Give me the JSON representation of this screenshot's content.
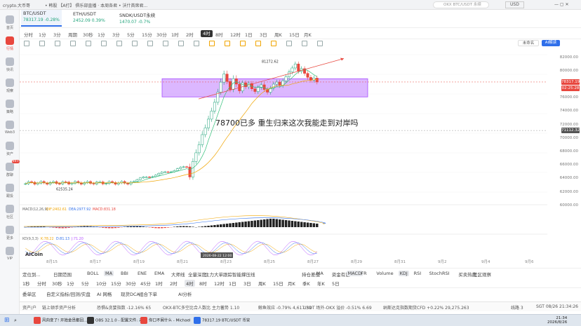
{
  "titlebar": {
    "app_name": "crypto.大币哥",
    "tabs_text": "• 韩股 【A打】 俱乐部直播 · 本周各君 • 沃什首席君...",
    "search_placeholder": "OKX BTC/USDT 永续",
    "currency": "USD"
  },
  "sidebar": {
    "items": [
      {
        "label": "首页"
      },
      {
        "label": "行情",
        "active": true
      },
      {
        "label": "快讯"
      },
      {
        "label": "观察"
      },
      {
        "label": "策略"
      },
      {
        "label": "Web3"
      },
      {
        "label": "资产"
      },
      {
        "label": "群聊",
        "badge": "99+"
      },
      {
        "label": "跟投"
      },
      {
        "label": "社区"
      },
      {
        "label": "更多"
      },
      {
        "label": "VIP"
      }
    ]
  },
  "tickers": [
    {
      "name": "BTC/USDT",
      "price": "78317.19",
      "change": "-0.28%",
      "active": true
    },
    {
      "name": "ETH/USDT",
      "price": "2452.09",
      "change": "0.39%"
    },
    {
      "name": "SNDK/USDT永续",
      "price": "1470.07",
      "change": "-0.7%"
    }
  ],
  "timeframes": [
    "1秒",
    "15秒",
    "1分",
    "3分",
    "5分",
    "10分",
    "15分",
    "30分",
    "45分",
    "1时",
    "2时",
    "3时",
    "4时",
    "8时",
    "12时",
    "1日",
    "3日",
    "周K",
    "15日",
    "月K"
  ],
  "timeframes_top": [
    "分时",
    "1分",
    "3分",
    "周期",
    "30秒",
    "1分",
    "3分",
    "5分",
    "15分",
    "30分",
    "1时",
    "2时",
    "4时",
    "8时",
    "12时",
    "1日",
    "3日",
    "周K",
    "15日",
    "月K"
  ],
  "active_timeframe": "4时",
  "toolbar": {
    "right_label": "未命名",
    "ai_button": "AI解读"
  },
  "price_axis": {
    "labels": [
      "82000.00",
      "80000.00",
      "76000.00",
      "74000.00",
      "72000.00",
      "70000.00",
      "68000.00",
      "66000.00",
      "64000.00",
      "62000.00",
      "60000.00"
    ],
    "current_price": "78317.19",
    "countdown": "02:25:28",
    "crosshair_price": "71112.32"
  },
  "chart_annotations": {
    "high_label": "81272.62",
    "low_label": "62535.24",
    "overlay_text": "78700已多 重生归来这次我能走到对岸吗",
    "watermark": "AiCoin",
    "time_tooltip": "2026-08-22 12:00"
  },
  "x_axis": [
    "8月15",
    "8月17",
    "8月19",
    "8月21",
    "8月23",
    "8月25",
    "8月27",
    "8月29",
    "8月31",
    "9月2",
    "9月4",
    "9月6"
  ],
  "macd": {
    "label": "MACD(12,26,9)",
    "dif": "DIF:2402.61",
    "dea": "DEA:2977.92",
    "macd": "MACD:831.18"
  },
  "kdj": {
    "label": "KD(9,3,3)",
    "k": "K:78.22",
    "d": "D:81.13",
    "j": "J:71.20"
  },
  "indicator_bar1": {
    "left": [
      "定位到...",
      "日期范围"
    ],
    "main_indicators": [
      "BOLL",
      "MA",
      "BBI",
      "ENE",
      "EMA",
      "大师线",
      "全量深度",
      "主力大单跟踪",
      "智能撑压线"
    ],
    "sub_indicators": [
      "持仓差值",
      "MA",
      "资金有量",
      "MACD",
      "FR",
      "Volume",
      "KDJ",
      "RSI",
      "StochRSI",
      "买卖热度",
      "社区观察"
    ],
    "active_main": "MA",
    "active_sub": [
      "MACD",
      "KDJ"
    ]
  },
  "indicator_bar2": {
    "timeframes": [
      "1秒",
      "分时",
      "30秒",
      "1分",
      "5分",
      "10分",
      "15分",
      "30分",
      "45分",
      "1时",
      "2时",
      "4时",
      "8时",
      "12时",
      "1日",
      "3日",
      "周K",
      "15日",
      "月K",
      "季K",
      "年K",
      "5日"
    ],
    "active": "4时"
  },
  "indicator_bar3": [
    "委单区",
    "自定义指标/回测/实盘",
    "AI 网格",
    "现货DCA",
    "组合下单",
    "AI分析"
  ],
  "statusbar": {
    "items": [
      {
        "text": "资产/户"
      },
      {
        "text": "链上顿手资产分析"
      },
      {
        "text": "恐惧&贪婪指数 -12.16%  65"
      },
      {
        "text": "OKX-BTC多空比合人数比  主力蓄势 1.10"
      },
      {
        "text": "鲸鱼效应 -0.79%  4,617.39"
      },
      {
        "text": "USDT 场外-OKX  溢价 -0.51%  6.69"
      },
      {
        "text": "纳斯达克指数期货CFD +0.22%  29,275.263"
      },
      {
        "text": "线路 3"
      },
      {
        "text": "SGT 08/26 21:34:26"
      }
    ]
  },
  "taskbar": {
    "apps": [
      {
        "label": "风向变了! 开始金员都回..."
      },
      {
        "label": "OBS 32.1.0 - 配置文件: 未..."
      },
      {
        "label": "你口不屑什么 - Michael"
      },
      {
        "label": "78317.19 BTC/USDT 币安"
      }
    ],
    "time": "21:34",
    "date": "2026/8/26"
  },
  "colors": {
    "up": "#1fa37a",
    "down": "#e8473e",
    "box": "#a64dff",
    "ma_yellow": "#f0a400",
    "ma_green": "#33c07a",
    "trend_red": "#e8473e"
  }
}
